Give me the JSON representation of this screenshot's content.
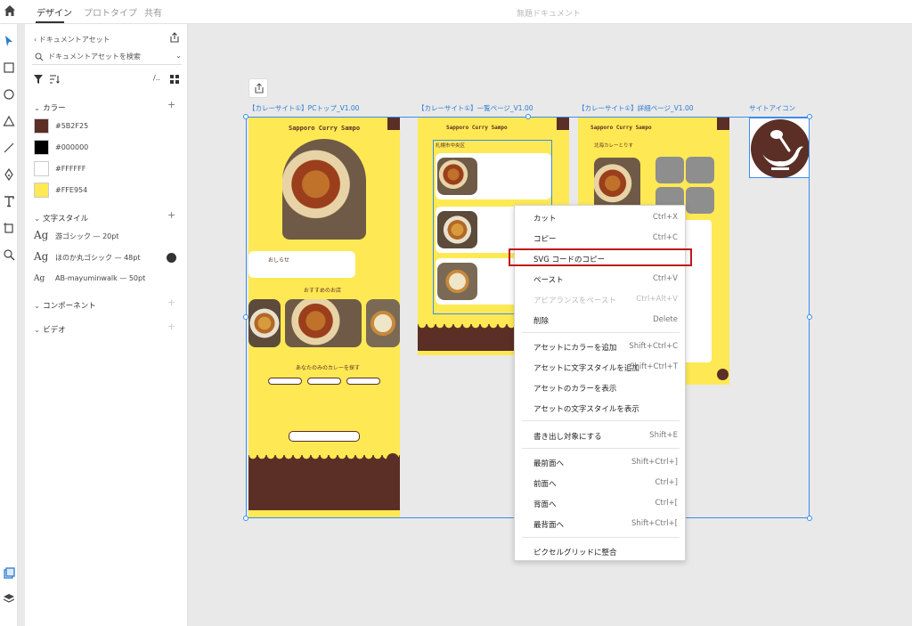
{
  "topbar": {
    "tabs": [
      "デザイン",
      "プロトタイプ",
      "共有"
    ],
    "doc_title": "無題ドキュメント"
  },
  "panel": {
    "breadcrumb": "ドキュメントアセット",
    "search_placeholder": "ドキュメントアセットを検索",
    "colors_title": "カラー",
    "colors": [
      {
        "hex": "#5B2F25",
        "label": "#5B2F25"
      },
      {
        "hex": "#000000",
        "label": "#000000"
      },
      {
        "hex": "#FFFFFF",
        "label": "#FFFFFF"
      },
      {
        "hex": "#FFE954",
        "label": "#FFE954"
      }
    ],
    "char_styles_title": "文字スタイル",
    "char_styles": [
      {
        "glyph": "Ag",
        "label": "游ゴシック — 20pt"
      },
      {
        "glyph": "Ag",
        "label": "ほのか丸ゴシック — 48pt"
      },
      {
        "glyph": "Ag",
        "label": "AB-mayuminwalk — 50pt"
      }
    ],
    "components_title": "コンポーネント",
    "video_title": "ビデオ"
  },
  "canvas": {
    "artboards": [
      {
        "label": "【カレーサイト①】PCトップ_V1.00",
        "site_title": "Sapporo Curry Sampo",
        "notice": "おしらせ",
        "recommend": "おすすめのお店",
        "find": "あなたのみのカレーを探す"
      },
      {
        "label": "【カレーサイト①】一覧ページ_V1.00",
        "site_title": "Sapporo Curry Sampo",
        "area": "札幌市中央区"
      },
      {
        "label": "【カレーサイト①】詳細ページ_V1.00",
        "site_title": "Sapporo Curry Sampo",
        "shop": "北海カレーとりす"
      },
      {
        "label": "サイトアイコン"
      }
    ]
  },
  "context_menu": {
    "items": [
      {
        "label": "カット",
        "shortcut": "Ctrl+X",
        "disabled": false
      },
      {
        "label": "コピー",
        "shortcut": "Ctrl+C",
        "disabled": false
      },
      {
        "label": "SVG コードのコピー",
        "shortcut": "",
        "disabled": false
      },
      {
        "label": "ペースト",
        "shortcut": "Ctrl+V",
        "disabled": false
      },
      {
        "label": "アピアランスをペースト",
        "shortcut": "Ctrl+Alt+V",
        "disabled": true
      },
      {
        "label": "削除",
        "shortcut": "Delete",
        "disabled": false
      },
      {
        "label": "アセットにカラーを追加",
        "shortcut": "Shift+Ctrl+C",
        "disabled": false
      },
      {
        "label": "アセットに文字スタイルを追加",
        "shortcut": "Shift+Ctrl+T",
        "disabled": false
      },
      {
        "label": "アセットのカラーを表示",
        "shortcut": "",
        "disabled": false
      },
      {
        "label": "アセットの文字スタイルを表示",
        "shortcut": "",
        "disabled": false
      },
      {
        "label": "書き出し対象にする",
        "shortcut": "Shift+E",
        "disabled": false
      },
      {
        "label": "最前面へ",
        "shortcut": "Shift+Ctrl+]",
        "disabled": false
      },
      {
        "label": "前面へ",
        "shortcut": "Ctrl+]",
        "disabled": false
      },
      {
        "label": "背面へ",
        "shortcut": "Ctrl+[",
        "disabled": false
      },
      {
        "label": "最背面へ",
        "shortcut": "Shift+Ctrl+[",
        "disabled": false
      },
      {
        "label": "ピクセルグリッドに整合",
        "shortcut": "",
        "disabled": false
      }
    ],
    "highlighted": "SVG コードのコピー"
  },
  "colors": {
    "brown": "#5B2F25",
    "yellow": "#FFE954",
    "selection": "#3A8CF0",
    "highlight": "#C0181E"
  }
}
